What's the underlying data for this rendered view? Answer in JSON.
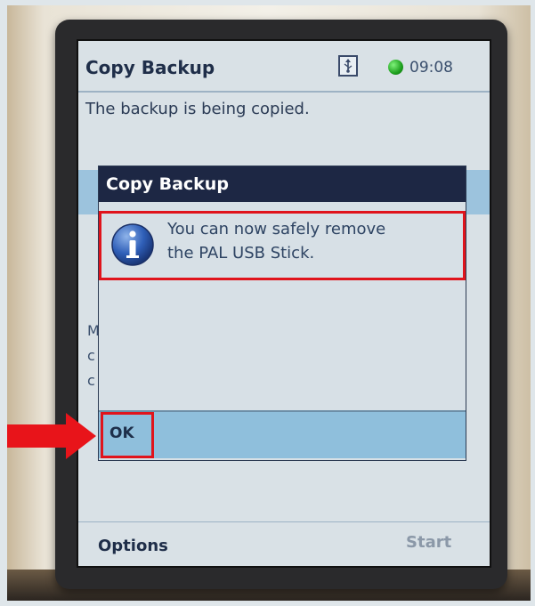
{
  "titlebar": {
    "title": "Copy Backup",
    "usb_icon": "usb-icon",
    "status_icon": "green-status-icon",
    "time": "09:08"
  },
  "main": {
    "status_message": "The backup is being copied."
  },
  "dialog": {
    "title": "Copy Backup",
    "icon": "info-icon",
    "message_line1": "You can now safely remove",
    "message_line2": "the PAL USB Stick.",
    "ok_label": "OK"
  },
  "softkeys": {
    "left": "Options",
    "right": "Start"
  },
  "colors": {
    "dialog_header": "#1d2744",
    "highlight": "#e0141c",
    "selection": "#8fbfdc",
    "pointer_arrow": "#e8141a"
  }
}
